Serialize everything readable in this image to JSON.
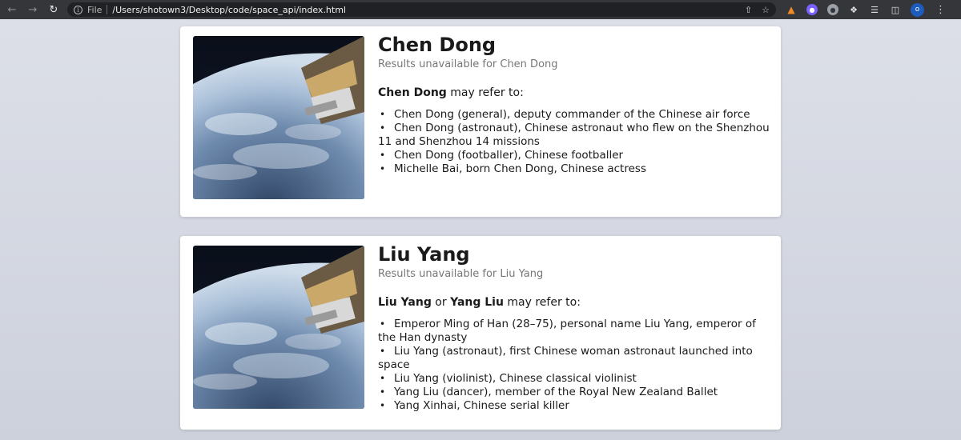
{
  "browser": {
    "file_label": "File",
    "url": "/Users/shotown3/Desktop/code/space_api/index.html",
    "profile_initial": "o"
  },
  "cards": [
    {
      "title": "Chen Dong",
      "subtitle": "Results unavailable for Chen Dong",
      "intro_parts": [
        "Chen Dong",
        " may refer to:"
      ],
      "items": [
        "Chen Dong (general), deputy commander of the Chinese air force",
        "Chen Dong (astronaut), Chinese astronaut who flew on the Shenzhou 11 and Shenzhou 14 missions",
        "Chen Dong (footballer), Chinese footballer",
        "Michelle Bai, born Chen Dong, Chinese actress"
      ]
    },
    {
      "title": "Liu Yang",
      "subtitle": "Results unavailable for Liu Yang",
      "intro_parts": [
        "Liu Yang",
        " or ",
        "Yang Liu",
        " may refer to:"
      ],
      "items": [
        "Emperor Ming of Han (28–75), personal name Liu Yang, emperor of the Han dynasty",
        "Liu Yang (astronaut), first Chinese woman astronaut launched into space",
        "Liu Yang (violinist), Chinese classical violinist",
        "Yang Liu (dancer), member of the Royal New Zealand Ballet",
        "Yang Xinhai, Chinese serial killer"
      ]
    }
  ]
}
